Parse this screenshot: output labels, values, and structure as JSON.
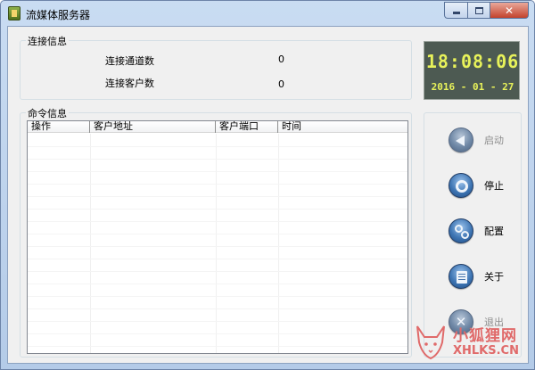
{
  "window": {
    "title": "流媒体服务器",
    "close_glyph": "✕"
  },
  "connection_group": {
    "title": "连接信息",
    "channels_label": "连接通道数",
    "channels_value": "0",
    "clients_label": "连接客户数",
    "clients_value": "0"
  },
  "clock": {
    "time": "18:08:06",
    "date": "2016 - 01 - 27"
  },
  "command_group": {
    "title": "命令信息",
    "columns": [
      "操作",
      "客户地址",
      "客户端口",
      "时间"
    ],
    "rows": []
  },
  "actions": {
    "start": {
      "label": "启动",
      "enabled": false,
      "icon": "back-arrow-icon"
    },
    "stop": {
      "label": "停止",
      "enabled": true,
      "icon": "stop-ring-icon"
    },
    "config": {
      "label": "配置",
      "enabled": true,
      "icon": "gears-icon"
    },
    "about": {
      "label": "关于",
      "enabled": true,
      "icon": "document-icon"
    },
    "exit": {
      "label": "退出",
      "enabled": false,
      "icon": "close-x-icon"
    }
  },
  "watermark": {
    "name": "小狐狸网",
    "url": "XHLKS.CN"
  },
  "colors": {
    "clock_bg": "#4d5a52",
    "clock_digits": "#e8f25a",
    "button_blue": "#3f76b4",
    "watermark": "#e06a6a"
  }
}
